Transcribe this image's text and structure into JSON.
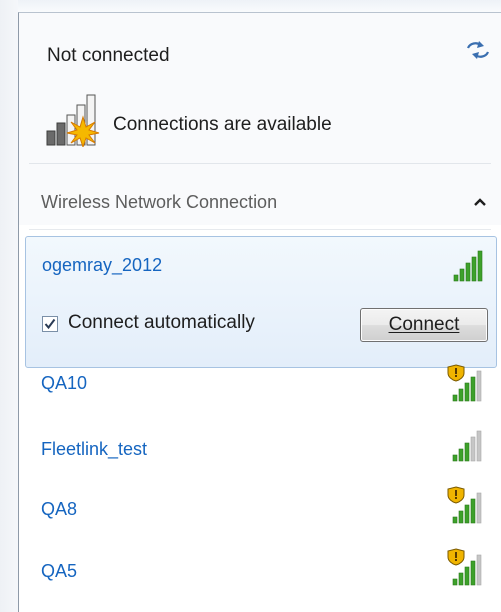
{
  "status": {
    "title": "Not connected",
    "availability": "Connections are available"
  },
  "section": {
    "label": "Wireless Network Connection"
  },
  "selected_network": {
    "name": "ogemray_2012",
    "auto_label": "Connect automatically",
    "auto_checked": true,
    "connect_label": "Connect",
    "signal_bars": 5,
    "secured": false
  },
  "networks": [
    {
      "name": "QA10",
      "signal_bars": 4,
      "secured": true
    },
    {
      "name": "Fleetlink_test",
      "signal_bars": 3,
      "secured": false
    },
    {
      "name": "QA8",
      "signal_bars": 4,
      "secured": true
    },
    {
      "name": "QA5",
      "signal_bars": 4,
      "secured": true
    }
  ],
  "colors": {
    "link": "#1565c0",
    "signal": "#3da12a",
    "signal_off": "#c6c6c6",
    "shield": "#f0b400"
  }
}
